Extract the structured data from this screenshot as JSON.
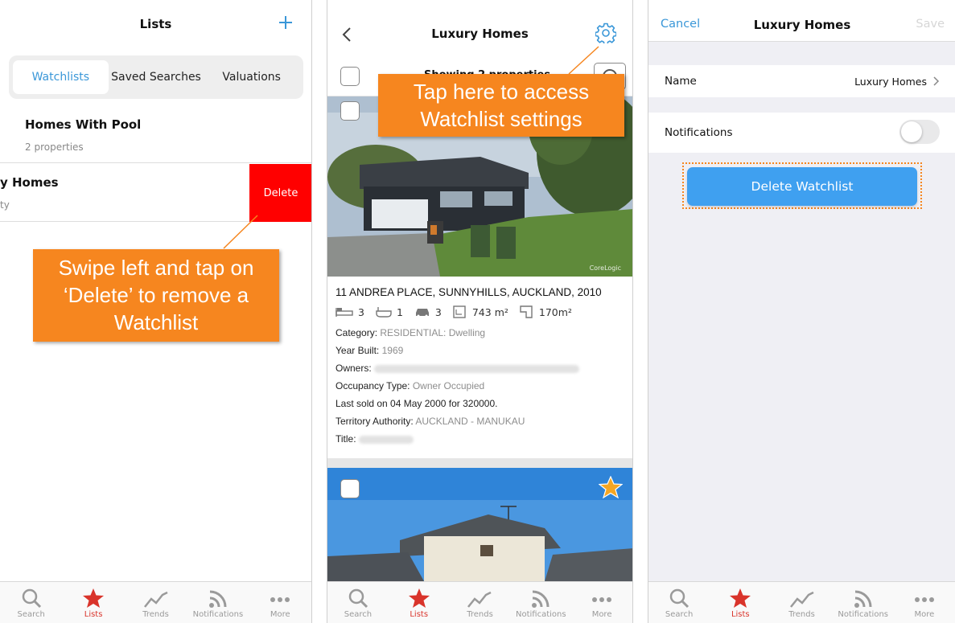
{
  "panel1": {
    "title": "Lists",
    "tabs": [
      "Watchlists",
      "Saved Searches",
      "Valuations"
    ],
    "items": [
      {
        "name": "Homes With Pool",
        "count": "2 properties"
      },
      {
        "name": "y Homes",
        "count": "ty"
      }
    ],
    "delete_label": "Delete",
    "callout": "Swipe left and tap on ‘Delete’ to remove a Watchlist"
  },
  "panel2": {
    "title": "Luxury Homes",
    "header_partial": "Showing 2 properties",
    "callout": "Tap here to access Watchlist settings",
    "watermark": "CoreLogic",
    "property": {
      "address": "11 ANDREA PLACE, SUNNYHILLS, AUCKLAND, 2010",
      "beds": "3",
      "baths": "1",
      "cars": "3",
      "land": "743 m²",
      "floor": "170m²",
      "category_label": "Category:",
      "category_value": "RESIDENTIAL: Dwelling",
      "year_label": "Year Built:",
      "year_value": "1969",
      "owners_label": "Owners:",
      "occupancy_label": "Occupancy Type:",
      "occupancy_value": "Owner Occupied",
      "last_sold": "Last sold on 04 May 2000 for 320000.",
      "territory_label": "Territory Authority:",
      "territory_value": "AUCKLAND - MANUKAU",
      "title_label": "Title:"
    }
  },
  "panel3": {
    "cancel": "Cancel",
    "title": "Luxury Homes",
    "save": "Save",
    "name_label": "Name",
    "name_value": "Luxury Homes",
    "notifications_label": "Notifications",
    "notifications_on": false,
    "delete_button": "Delete Watchlist"
  },
  "tabbar": [
    "Search",
    "Lists",
    "Trends",
    "Notifications",
    "More"
  ],
  "colors": {
    "accent": "#3a97d8",
    "delete_red": "#ff0000",
    "callout_orange": "#f6861f",
    "active_tab": "#d9342b"
  }
}
